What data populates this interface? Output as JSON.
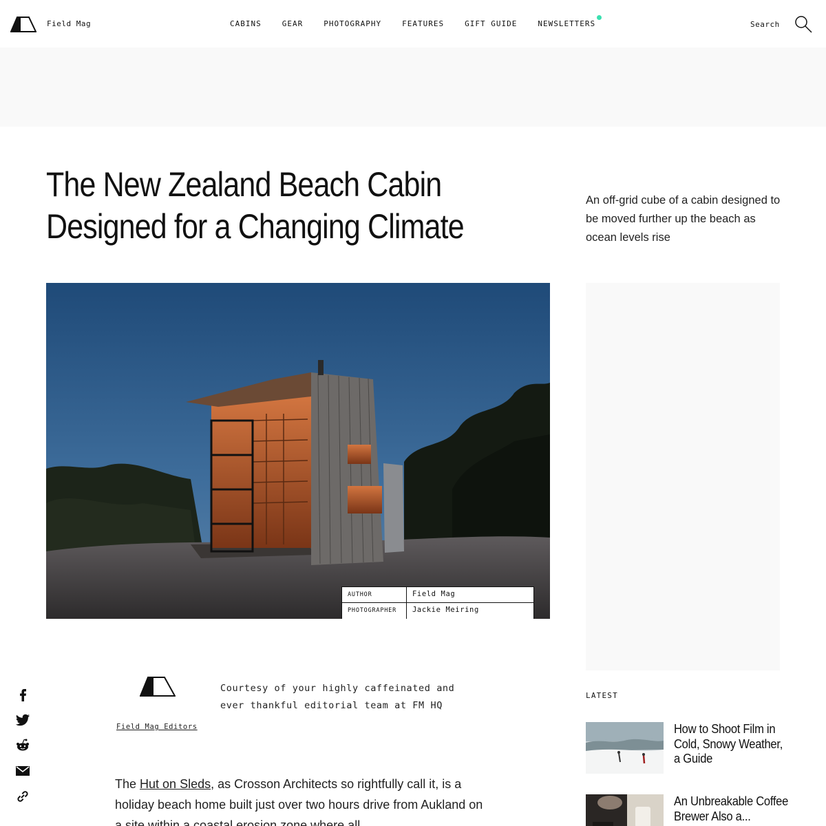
{
  "header": {
    "brand": "Field Mag",
    "nav": [
      "CABINS",
      "GEAR",
      "PHOTOGRAPHY",
      "FEATURES",
      "GIFT GUIDE",
      "NEWSLETTERS"
    ],
    "search_label": "Search"
  },
  "article": {
    "title_line1": "The New Zealand Beach Cabin",
    "title_line2": "Designed for a Changing Climate",
    "dek": "An off-grid cube of a cabin designed to be moved further up the beach as ocean levels rise",
    "credits": [
      {
        "label": "AUTHOR",
        "value": "Field Mag"
      },
      {
        "label": "PHOTOGRAPHER",
        "value": "Jackie Meiring"
      }
    ],
    "author_name": "Field Mag Editors",
    "author_bio": "Courtesy of your highly caffeinated and ever thankful editorial team at FM HQ",
    "body_intro": "The ",
    "body_link": "Hut on Sleds",
    "body_rest": ", as Crosson Architects so rightfully call it, is a holiday beach home built just over two hours drive from Aukland on a site within a coastal erosion zone where all"
  },
  "share": [
    "facebook-icon",
    "twitter-icon",
    "reddit-icon",
    "email-icon",
    "link-icon"
  ],
  "latest": {
    "label": "LATEST",
    "items": [
      {
        "title": "How to Shoot Film in Cold, Snowy Weather, a Guide"
      },
      {
        "title": "An Unbreakable Coffee Brewer Also a..."
      }
    ]
  },
  "colors": {
    "accent_dot": "#3be0b0",
    "ad_background": "#f9f9f9"
  }
}
